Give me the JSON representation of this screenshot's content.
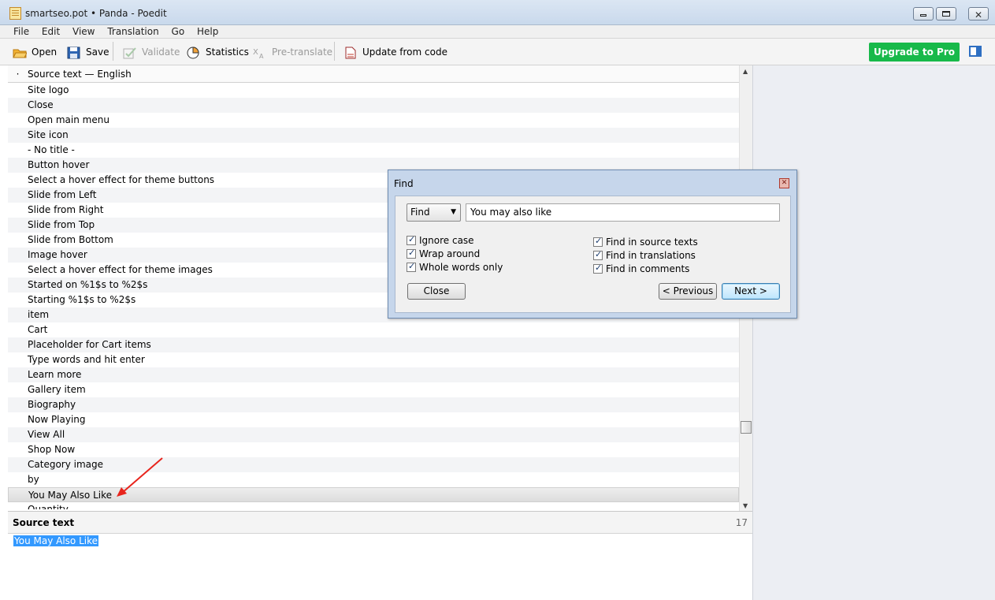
{
  "window": {
    "title": "smartseo.pot • Panda - Poedit"
  },
  "menu": [
    "File",
    "Edit",
    "View",
    "Translation",
    "Go",
    "Help"
  ],
  "toolbar": {
    "open": "Open",
    "save": "Save",
    "validate": "Validate",
    "statistics": "Statistics",
    "pretranslate": "Pre-translate",
    "update": "Update from code",
    "upgrade": "Upgrade to Pro"
  },
  "list": {
    "header_bullet": "·",
    "header": "Source text — English",
    "rows": [
      "Site logo",
      "Close",
      "Open main menu",
      "Site icon",
      "- No title -",
      "Button hover",
      "Select a hover effect for theme buttons",
      "Slide from Left",
      "Slide from Right",
      "Slide from Top",
      "Slide from Bottom",
      "Image hover",
      "Select a hover effect for theme images",
      "Started on %1$s to %2$s",
      "Starting %1$s to %2$s",
      "item",
      "Cart",
      "Placeholder for Cart items",
      "Type words and hit enter",
      "Learn more",
      "Gallery item",
      "Biography",
      "Now Playing",
      "View All",
      "Shop Now",
      "Category image",
      "by",
      "You May Also Like",
      "Quantity"
    ],
    "selected_row": "You May Also Like"
  },
  "source_pane": {
    "label": "Source text",
    "count": "17",
    "text": "You May Also Like"
  },
  "find_dialog": {
    "title": "Find",
    "mode": "Find",
    "query": "You may also like",
    "options_left": [
      "Ignore case",
      "Wrap around",
      "Whole words only"
    ],
    "options_right": [
      "Find in source texts",
      "Find in translations",
      "Find in comments"
    ],
    "close": "Close",
    "previous": "< Previous",
    "next": "Next >"
  },
  "colors": {
    "upgrade": "#18b94a",
    "selection": "#3399ff",
    "annotation_arrow": "#e8241c"
  }
}
